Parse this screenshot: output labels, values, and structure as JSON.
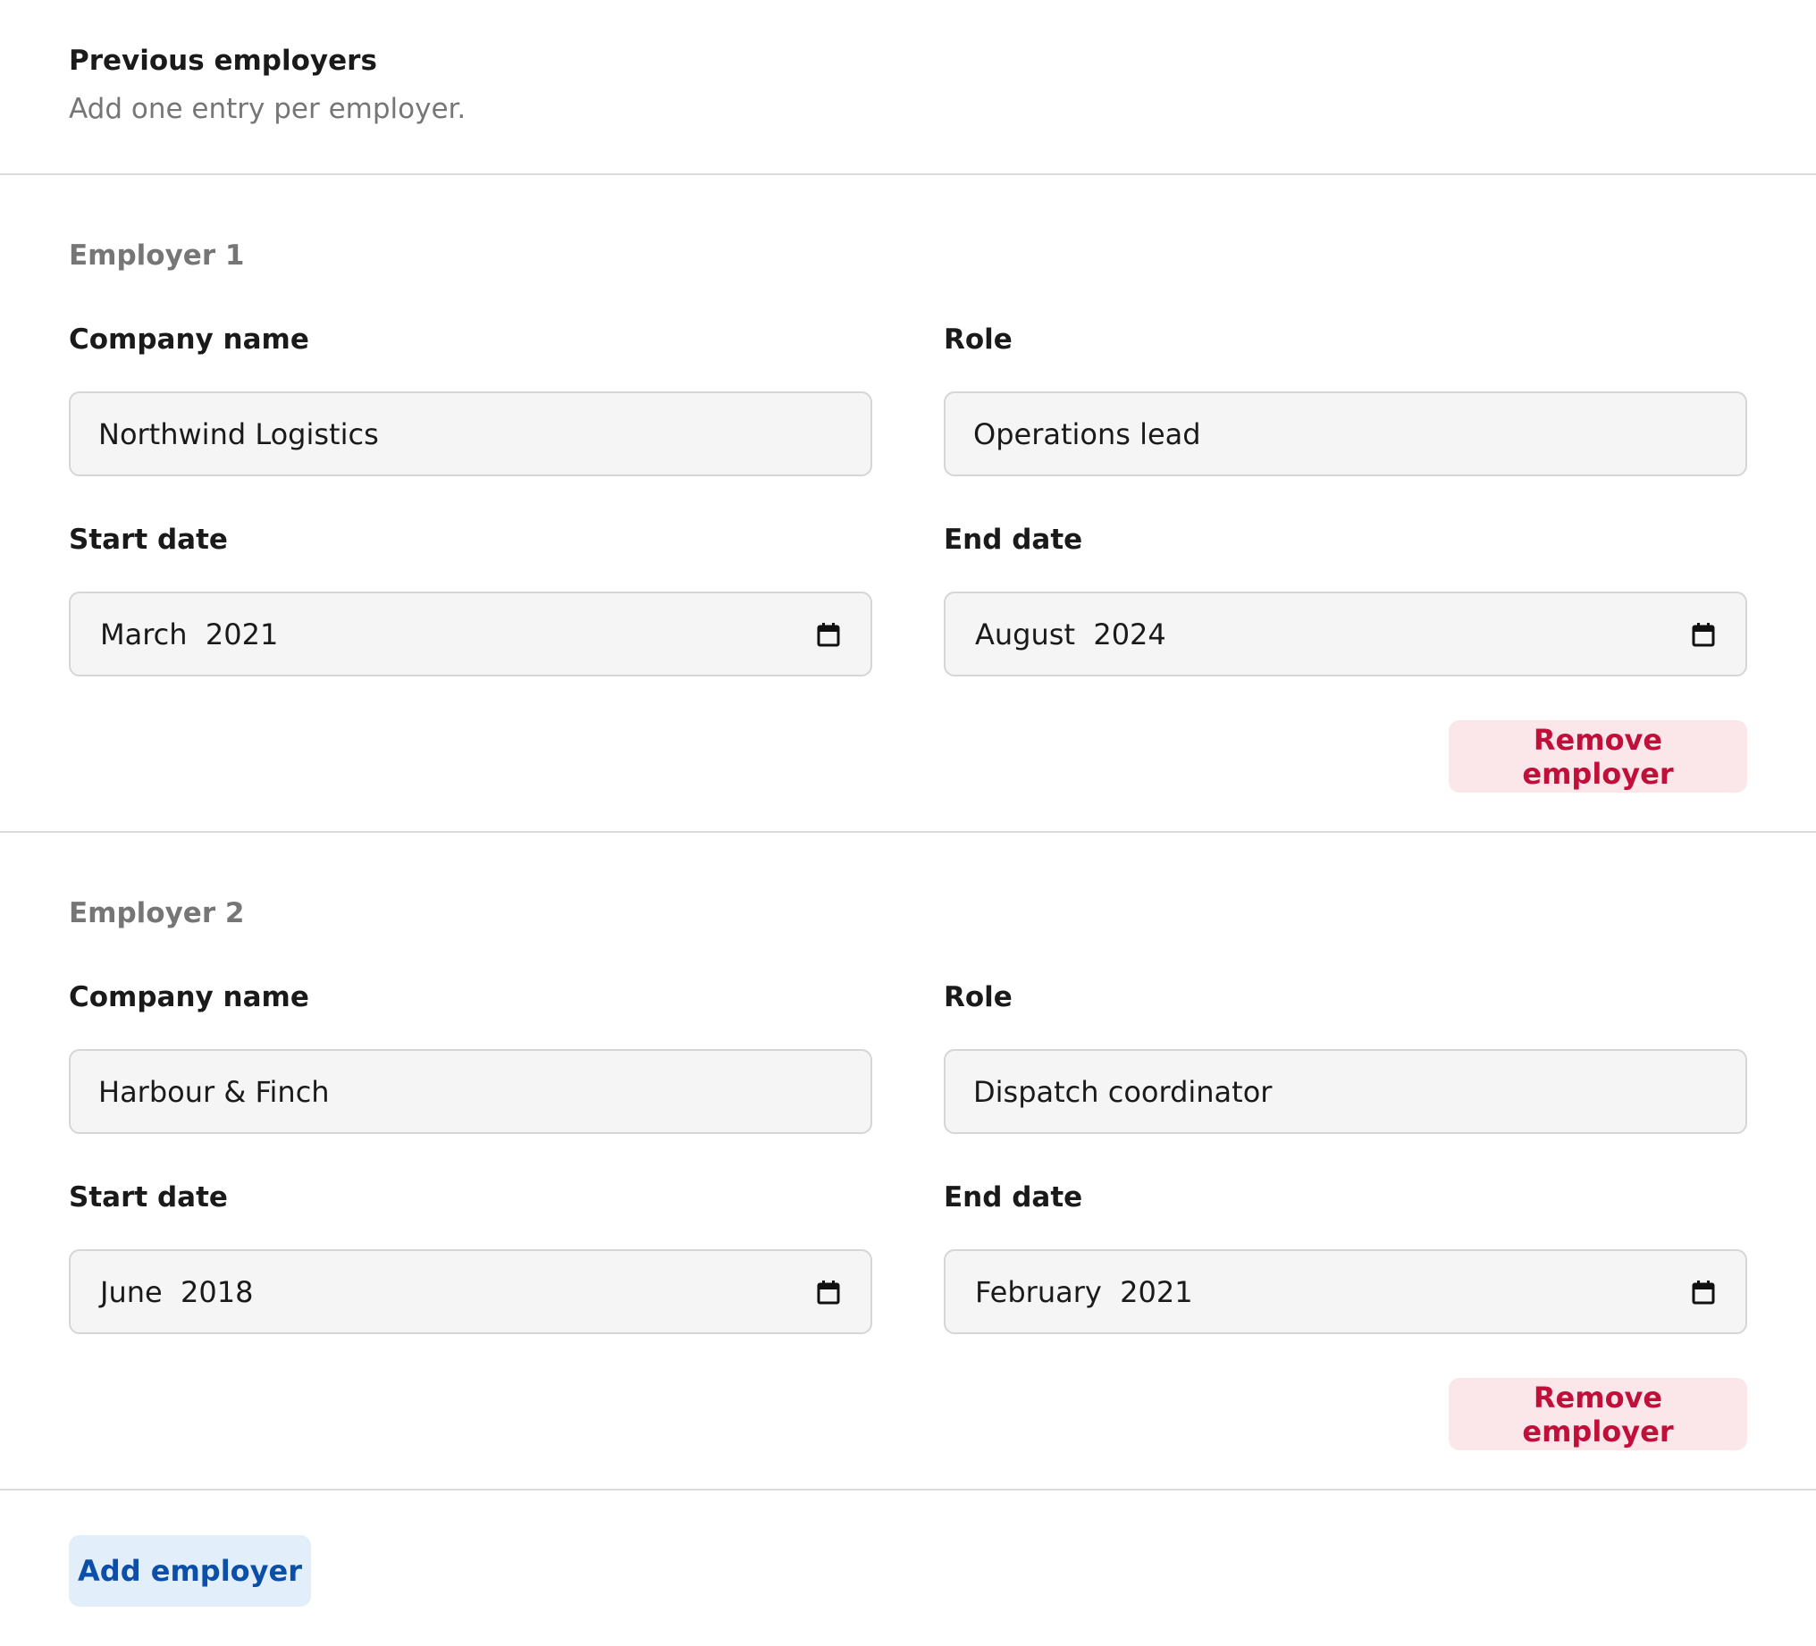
{
  "header": {
    "title": "Previous employers",
    "subtitle": "Add one entry per employer."
  },
  "labels": {
    "company": "Company name",
    "role": "Role",
    "start": "Start date",
    "end": "End date"
  },
  "employers": [
    {
      "title": "Employer 1",
      "company": "Northwind Logistics",
      "role": "Operations lead",
      "start_date": "March  2021",
      "end_date": "August  2024",
      "remove_label": "Remove employer"
    },
    {
      "title": "Employer 2",
      "company": "Harbour & Finch",
      "role": "Dispatch coordinator",
      "start_date": "June  2018",
      "end_date": "February  2021",
      "remove_label": "Remove employer"
    }
  ],
  "actions": {
    "add_label": "Add employer"
  },
  "icons": {
    "date_picker": "calendar-icon"
  },
  "colors": {
    "remove_bg": "#fbe6ea",
    "remove_text": "#c0103a",
    "add_bg": "#e2eefa",
    "add_text": "#0b4fa8",
    "muted_text": "#767676"
  }
}
